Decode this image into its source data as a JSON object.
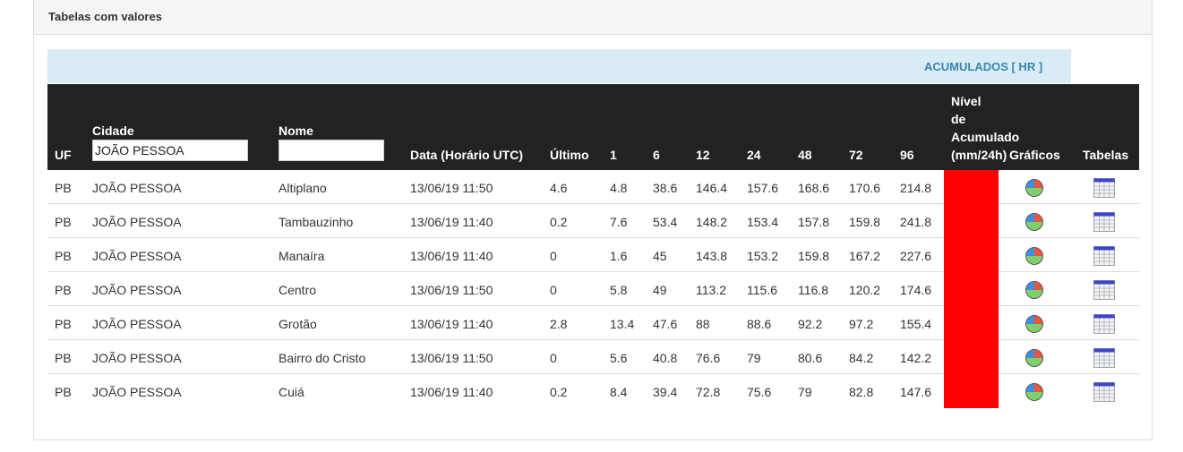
{
  "panel": {
    "title": "Tabelas com valores"
  },
  "banner": {
    "label": "ACUMULADOS [ HR ]",
    "background": "#d9ecf5",
    "text_color": "#3a87ad"
  },
  "headers": {
    "uf": "UF",
    "cidade": "Cidade",
    "cidade_filter_value": "JOÃO PESSOA",
    "nome": "Nome",
    "nome_filter_value": "",
    "data": "Data (Horário UTC)",
    "ultimo": "Último",
    "h1": "1",
    "h6": "6",
    "h12": "12",
    "h24": "24",
    "h48": "48",
    "h72": "72",
    "h96": "96",
    "nivel_line1": "Nível",
    "nivel_line2": "de",
    "nivel_line3": "Acumulado",
    "nivel_line4": "(mm/24h)",
    "graficos": "Gráficos",
    "tabelas": "Tabelas"
  },
  "colors": {
    "header_bg": "#222222",
    "nivel_level": "#ff0000"
  },
  "rows": [
    {
      "uf": "PB",
      "cidade": "JOÃO PESSOA",
      "nome": "Altiplano",
      "data": "13/06/19 11:50",
      "ultimo": "4.6",
      "h1": "4.8",
      "h6": "38.6",
      "h12": "146.4",
      "h24": "157.6",
      "h48": "168.6",
      "h72": "170.6",
      "h96": "214.8",
      "nivel_color": "#ff0000",
      "grafico_icon": "pie-chart-icon",
      "tabela_icon": "table-icon"
    },
    {
      "uf": "PB",
      "cidade": "JOÃO PESSOA",
      "nome": "Tambauzinho",
      "data": "13/06/19 11:40",
      "ultimo": "0.2",
      "h1": "7.6",
      "h6": "53.4",
      "h12": "148.2",
      "h24": "153.4",
      "h48": "157.8",
      "h72": "159.8",
      "h96": "241.8",
      "nivel_color": "#ff0000",
      "grafico_icon": "pie-chart-icon",
      "tabela_icon": "table-icon"
    },
    {
      "uf": "PB",
      "cidade": "JOÃO PESSOA",
      "nome": "Manaíra",
      "data": "13/06/19 11:40",
      "ultimo": "0",
      "h1": "1.6",
      "h6": "45",
      "h12": "143.8",
      "h24": "153.2",
      "h48": "159.8",
      "h72": "167.2",
      "h96": "227.6",
      "nivel_color": "#ff0000",
      "grafico_icon": "pie-chart-icon",
      "tabela_icon": "table-icon"
    },
    {
      "uf": "PB",
      "cidade": "JOÃO PESSOA",
      "nome": "Centro",
      "data": "13/06/19 11:50",
      "ultimo": "0",
      "h1": "5.8",
      "h6": "49",
      "h12": "113.2",
      "h24": "115.6",
      "h48": "116.8",
      "h72": "120.2",
      "h96": "174.6",
      "nivel_color": "#ff0000",
      "grafico_icon": "pie-chart-icon",
      "tabela_icon": "table-icon"
    },
    {
      "uf": "PB",
      "cidade": "JOÃO PESSOA",
      "nome": "Grotão",
      "data": "13/06/19 11:40",
      "ultimo": "2.8",
      "h1": "13.4",
      "h6": "47.6",
      "h12": "88",
      "h24": "88.6",
      "h48": "92.2",
      "h72": "97.2",
      "h96": "155.4",
      "nivel_color": "#ff0000",
      "grafico_icon": "pie-chart-icon",
      "tabela_icon": "table-icon"
    },
    {
      "uf": "PB",
      "cidade": "JOÃO PESSOA",
      "nome": "Bairro do Cristo",
      "data": "13/06/19 11:50",
      "ultimo": "0",
      "h1": "5.6",
      "h6": "40.8",
      "h12": "76.6",
      "h24": "79",
      "h48": "80.6",
      "h72": "84.2",
      "h96": "142.2",
      "nivel_color": "#ff0000",
      "grafico_icon": "pie-chart-icon",
      "tabela_icon": "table-icon"
    },
    {
      "uf": "PB",
      "cidade": "JOÃO PESSOA",
      "nome": "Cuiá",
      "data": "13/06/19 11:40",
      "ultimo": "0.2",
      "h1": "8.4",
      "h6": "39.4",
      "h12": "72.8",
      "h24": "75.6",
      "h48": "79",
      "h72": "82.8",
      "h96": "147.6",
      "nivel_color": "#ff0000",
      "grafico_icon": "pie-chart-icon",
      "tabela_icon": "table-icon"
    }
  ]
}
